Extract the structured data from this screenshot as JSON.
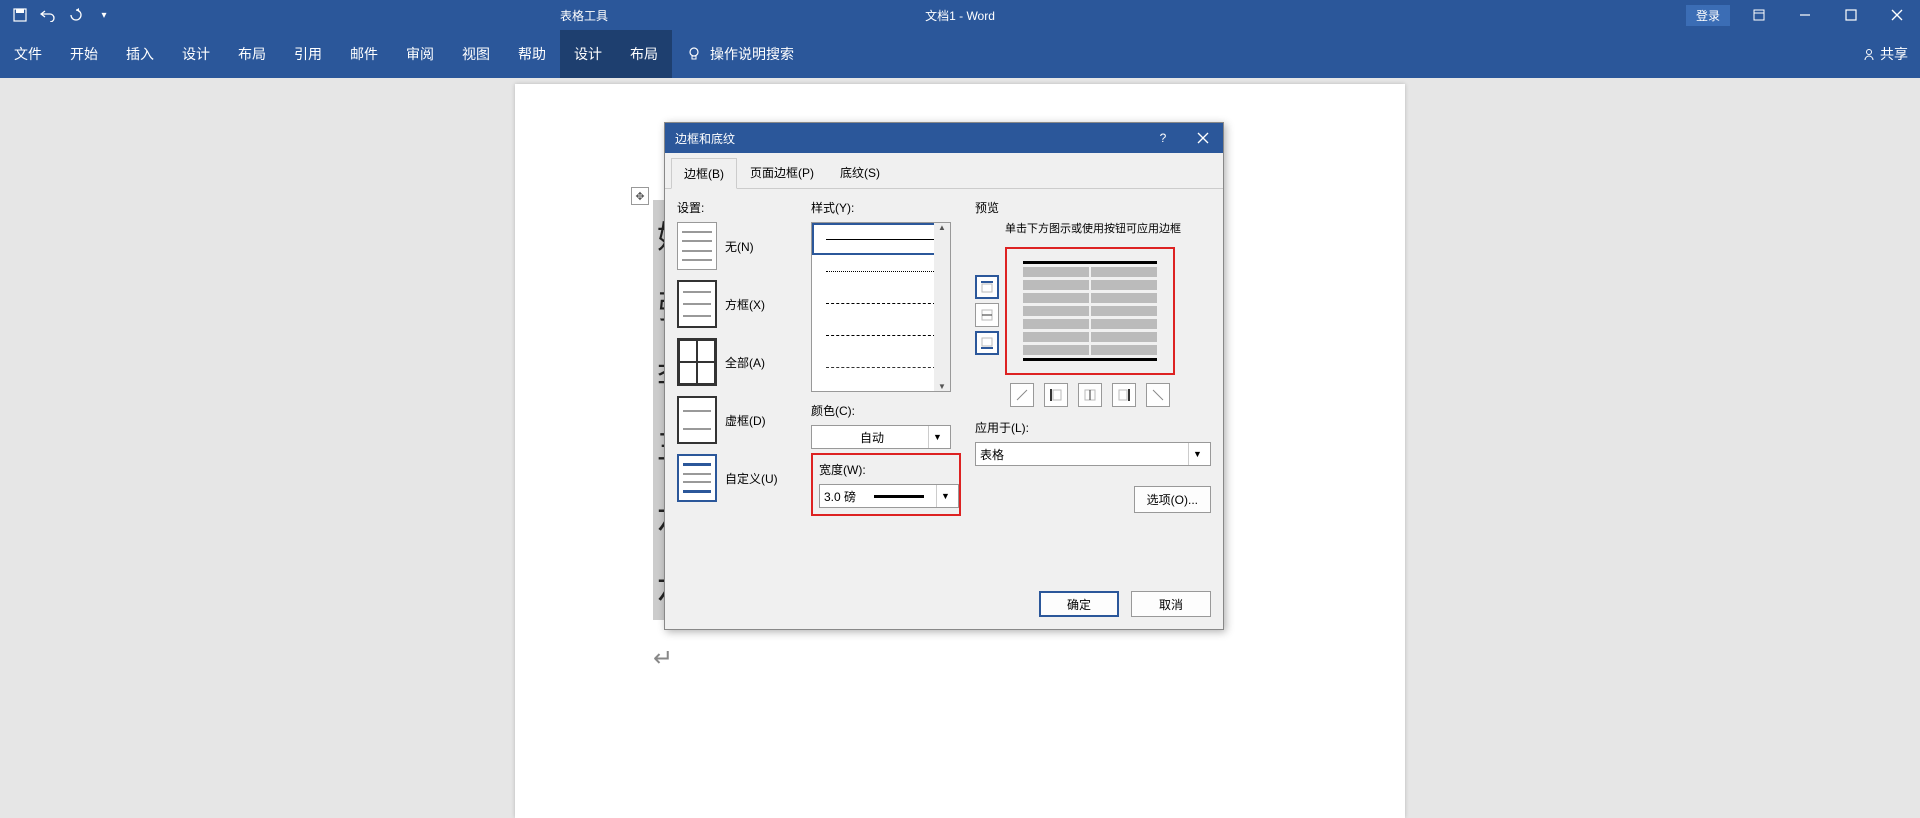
{
  "titlebar": {
    "context_tools": "表格工具",
    "doc_title": "文档1 - Word",
    "login": "登录"
  },
  "ribbon": {
    "tabs": [
      "文件",
      "开始",
      "插入",
      "设计",
      "布局",
      "引用",
      "邮件",
      "审阅",
      "视图",
      "帮助"
    ],
    "context_tabs": [
      "设计",
      "布局"
    ],
    "tell_me": "操作说明搜索",
    "share": "共享"
  },
  "table": {
    "rows": [
      "姓名",
      "张三",
      "李四",
      "王五",
      "六六",
      "六七"
    ]
  },
  "dialog": {
    "title": "边框和底纹",
    "tabs": {
      "border": "边框(B)",
      "page_border": "页面边框(P)",
      "shading": "底纹(S)"
    },
    "settings_label": "设置:",
    "settings": {
      "none": "无(N)",
      "box": "方框(X)",
      "all": "全部(A)",
      "grid": "虚框(D)",
      "custom": "自定义(U)"
    },
    "style_label": "样式(Y):",
    "color_label": "颜色(C):",
    "color_value": "自动",
    "width_label": "宽度(W):",
    "width_value": "3.0 磅",
    "preview_label": "预览",
    "preview_hint": "单击下方图示或使用按钮可应用边框",
    "apply_label": "应用于(L):",
    "apply_value": "表格",
    "options": "选项(O)...",
    "ok": "确定",
    "cancel": "取消"
  }
}
